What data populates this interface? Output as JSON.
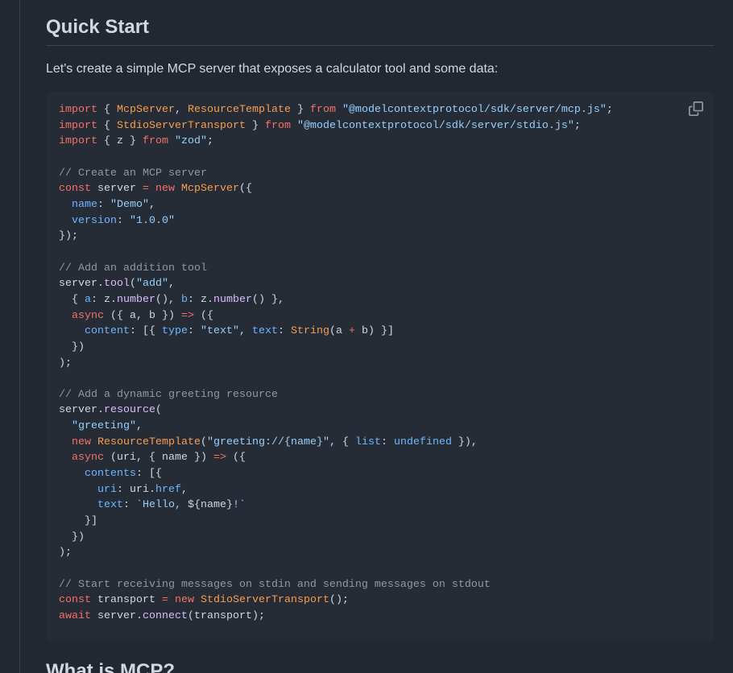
{
  "section": {
    "title": "Quick Start",
    "intro": "Let's create a simple MCP server that exposes a calculator tool and some data:"
  },
  "code_block": {
    "copy_icon": "copy-icon",
    "colors": {
      "keyword": "#f47067",
      "entity": "#f69d50",
      "string": "#96d0ff",
      "comment": "#9198a1",
      "function": "#dcbdfb",
      "constant": "#6cb6ff",
      "plain": "#d1d7e0",
      "background": "#262c36"
    },
    "lines": [
      [
        [
          "keyword",
          "import"
        ],
        [
          "plain",
          " { "
        ],
        [
          "entity",
          "McpServer"
        ],
        [
          "plain",
          ", "
        ],
        [
          "entity",
          "ResourceTemplate"
        ],
        [
          "plain",
          " } "
        ],
        [
          "keyword",
          "from"
        ],
        [
          "plain",
          " "
        ],
        [
          "string",
          "\"@modelcontextprotocol/sdk/server/mcp.js\""
        ],
        [
          "plain",
          ";"
        ]
      ],
      [
        [
          "keyword",
          "import"
        ],
        [
          "plain",
          " { "
        ],
        [
          "entity",
          "StdioServerTransport"
        ],
        [
          "plain",
          " } "
        ],
        [
          "keyword",
          "from"
        ],
        [
          "plain",
          " "
        ],
        [
          "string",
          "\"@modelcontextprotocol/sdk/server/stdio.js\""
        ],
        [
          "plain",
          ";"
        ]
      ],
      [
        [
          "keyword",
          "import"
        ],
        [
          "plain",
          " { z } "
        ],
        [
          "keyword",
          "from"
        ],
        [
          "plain",
          " "
        ],
        [
          "string",
          "\"zod\""
        ],
        [
          "plain",
          ";"
        ]
      ],
      [],
      [
        [
          "comment",
          "// Create an MCP server"
        ]
      ],
      [
        [
          "keyword",
          "const"
        ],
        [
          "plain",
          " server "
        ],
        [
          "keyword",
          "="
        ],
        [
          "plain",
          " "
        ],
        [
          "keyword",
          "new"
        ],
        [
          "plain",
          " "
        ],
        [
          "entity",
          "McpServer"
        ],
        [
          "plain",
          "({"
        ]
      ],
      [
        [
          "plain",
          "  "
        ],
        [
          "const",
          "name"
        ],
        [
          "plain",
          ": "
        ],
        [
          "string",
          "\"Demo\""
        ],
        [
          "plain",
          ","
        ]
      ],
      [
        [
          "plain",
          "  "
        ],
        [
          "const",
          "version"
        ],
        [
          "plain",
          ": "
        ],
        [
          "string",
          "\"1.0.0\""
        ]
      ],
      [
        [
          "plain",
          "});"
        ]
      ],
      [],
      [
        [
          "comment",
          "// Add an addition tool"
        ]
      ],
      [
        [
          "plain",
          "server."
        ],
        [
          "func",
          "tool"
        ],
        [
          "plain",
          "("
        ],
        [
          "string",
          "\"add\""
        ],
        [
          "plain",
          ","
        ]
      ],
      [
        [
          "plain",
          "  { "
        ],
        [
          "const",
          "a"
        ],
        [
          "plain",
          ": z."
        ],
        [
          "func",
          "number"
        ],
        [
          "plain",
          "(), "
        ],
        [
          "const",
          "b"
        ],
        [
          "plain",
          ": z."
        ],
        [
          "func",
          "number"
        ],
        [
          "plain",
          "() },"
        ]
      ],
      [
        [
          "plain",
          "  "
        ],
        [
          "keyword",
          "async"
        ],
        [
          "plain",
          " ({ a, b }) "
        ],
        [
          "keyword",
          "=>"
        ],
        [
          "plain",
          " ({"
        ]
      ],
      [
        [
          "plain",
          "    "
        ],
        [
          "const",
          "content"
        ],
        [
          "plain",
          ": [{ "
        ],
        [
          "const",
          "type"
        ],
        [
          "plain",
          ": "
        ],
        [
          "string",
          "\"text\""
        ],
        [
          "plain",
          ", "
        ],
        [
          "const",
          "text"
        ],
        [
          "plain",
          ": "
        ],
        [
          "entity",
          "String"
        ],
        [
          "plain",
          "(a "
        ],
        [
          "keyword",
          "+"
        ],
        [
          "plain",
          " b) }]"
        ]
      ],
      [
        [
          "plain",
          "  })"
        ]
      ],
      [
        [
          "plain",
          ");"
        ]
      ],
      [],
      [
        [
          "comment",
          "// Add a dynamic greeting resource"
        ]
      ],
      [
        [
          "plain",
          "server."
        ],
        [
          "func",
          "resource"
        ],
        [
          "plain",
          "("
        ]
      ],
      [
        [
          "plain",
          "  "
        ],
        [
          "string",
          "\"greeting\""
        ],
        [
          "plain",
          ","
        ]
      ],
      [
        [
          "plain",
          "  "
        ],
        [
          "keyword",
          "new"
        ],
        [
          "plain",
          " "
        ],
        [
          "entity",
          "ResourceTemplate"
        ],
        [
          "plain",
          "("
        ],
        [
          "string",
          "\"greeting://{name}\""
        ],
        [
          "plain",
          ", { "
        ],
        [
          "const",
          "list"
        ],
        [
          "plain",
          ": "
        ],
        [
          "const",
          "undefined"
        ],
        [
          "plain",
          " }),"
        ]
      ],
      [
        [
          "plain",
          "  "
        ],
        [
          "keyword",
          "async"
        ],
        [
          "plain",
          " (uri, { name }) "
        ],
        [
          "keyword",
          "=>"
        ],
        [
          "plain",
          " ({"
        ]
      ],
      [
        [
          "plain",
          "    "
        ],
        [
          "const",
          "contents"
        ],
        [
          "plain",
          ": [{"
        ]
      ],
      [
        [
          "plain",
          "      "
        ],
        [
          "const",
          "uri"
        ],
        [
          "plain",
          ": uri."
        ],
        [
          "const",
          "href"
        ],
        [
          "plain",
          ","
        ]
      ],
      [
        [
          "plain",
          "      "
        ],
        [
          "const",
          "text"
        ],
        [
          "plain",
          ": "
        ],
        [
          "string",
          "`Hello, "
        ],
        [
          "plain",
          "${name}"
        ],
        [
          "string",
          "!`"
        ]
      ],
      [
        [
          "plain",
          "    }]"
        ]
      ],
      [
        [
          "plain",
          "  })"
        ]
      ],
      [
        [
          "plain",
          ");"
        ]
      ],
      [],
      [
        [
          "comment",
          "// Start receiving messages on stdin and sending messages on stdout"
        ]
      ],
      [
        [
          "keyword",
          "const"
        ],
        [
          "plain",
          " transport "
        ],
        [
          "keyword",
          "="
        ],
        [
          "plain",
          " "
        ],
        [
          "keyword",
          "new"
        ],
        [
          "plain",
          " "
        ],
        [
          "entity",
          "StdioServerTransport"
        ],
        [
          "plain",
          "();"
        ]
      ],
      [
        [
          "keyword",
          "await"
        ],
        [
          "plain",
          " server."
        ],
        [
          "func",
          "connect"
        ],
        [
          "plain",
          "(transport);"
        ]
      ]
    ]
  },
  "next_section": {
    "title": "What is MCP?"
  }
}
